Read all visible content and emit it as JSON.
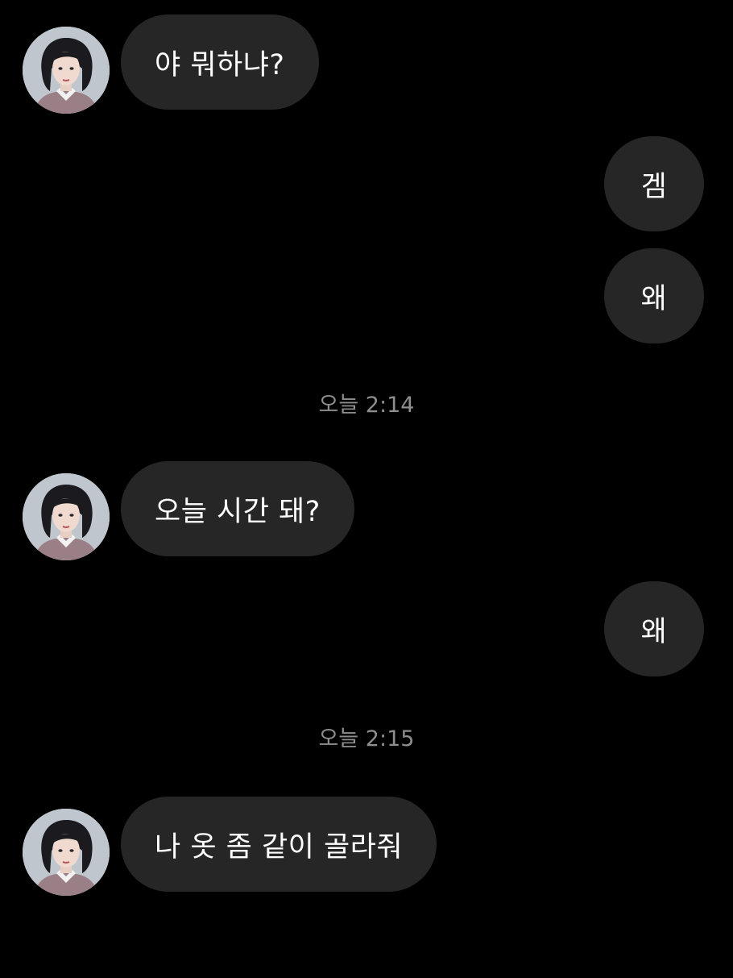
{
  "colors": {
    "background": "#000000",
    "bubble": "#262626",
    "text": "#ffffff",
    "timestamp": "#8e8e8e"
  },
  "contact": {
    "avatar_icon": "profile-photo-avatar"
  },
  "messages": [
    {
      "direction": "incoming",
      "text": "야 뭐하냐?"
    },
    {
      "direction": "outgoing",
      "text": "겜"
    },
    {
      "direction": "outgoing",
      "text": "왜"
    },
    {
      "direction": "timestamp",
      "text": "오늘 2:14"
    },
    {
      "direction": "incoming",
      "text": "오늘 시간 돼?"
    },
    {
      "direction": "outgoing",
      "text": "왜"
    },
    {
      "direction": "timestamp",
      "text": "오늘 2:15"
    },
    {
      "direction": "incoming",
      "text": "나 옷 좀 같이 골라줘"
    }
  ]
}
